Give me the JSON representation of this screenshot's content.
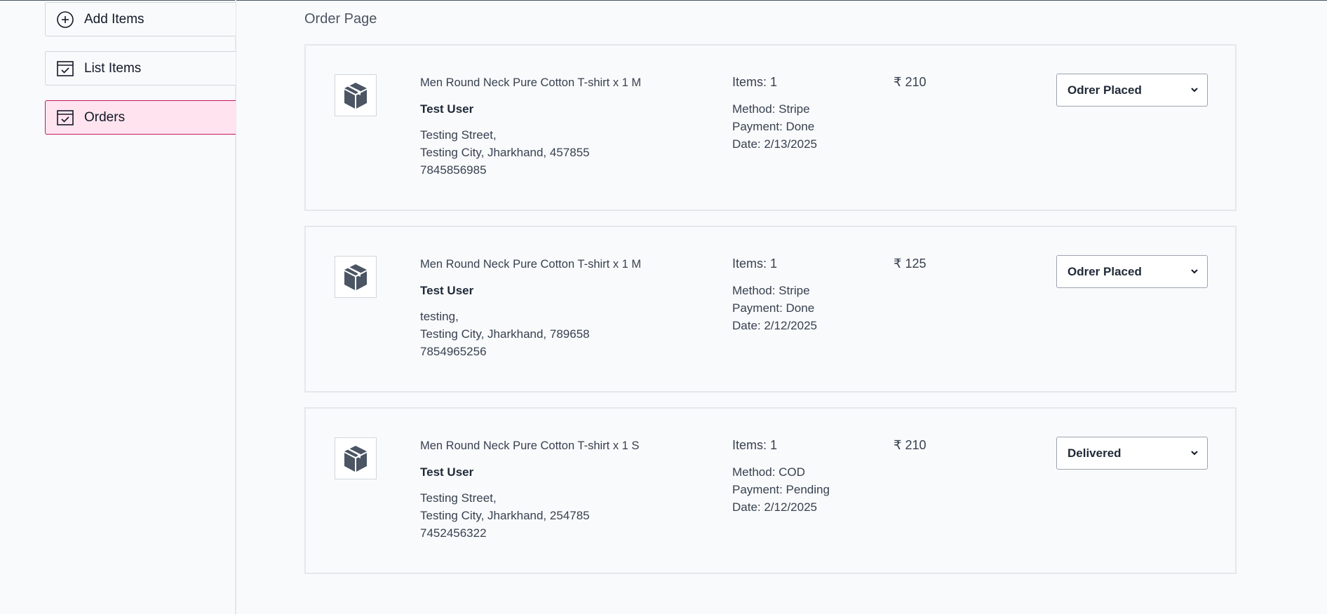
{
  "sidebar": {
    "items": [
      {
        "label": "Add Items",
        "icon": "plus-circle-icon"
      },
      {
        "label": "List Items",
        "icon": "calendar-check-icon"
      },
      {
        "label": "Orders",
        "icon": "calendar-check-icon",
        "active": true
      }
    ]
  },
  "main": {
    "title": "Order Page",
    "orders": [
      {
        "product": "Men Round Neck Pure Cotton T-shirt x 1 M",
        "customer": "Test User",
        "address_line1": "Testing Street,",
        "address_line2": "Testing City, Jharkhand, 457855",
        "phone": "7845856985",
        "items": "Items: 1",
        "method": "Method: Stripe",
        "payment": "Payment: Done",
        "date": "Date: 2/13/2025",
        "amount": "₹ 210",
        "status": "Odrer Placed"
      },
      {
        "product": "Men Round Neck Pure Cotton T-shirt x 1 M",
        "customer": "Test User",
        "address_line1": "testing,",
        "address_line2": "Testing City, Jharkhand, 789658",
        "phone": "7854965256",
        "items": "Items: 1",
        "method": "Method: Stripe",
        "payment": "Payment: Done",
        "date": "Date: 2/12/2025",
        "amount": "₹ 125",
        "status": "Odrer Placed"
      },
      {
        "product": "Men Round Neck Pure Cotton T-shirt x 1 S",
        "customer": "Test User",
        "address_line1": "Testing Street,",
        "address_line2": "Testing City, Jharkhand, 254785",
        "phone": "7452456322",
        "items": "Items: 1",
        "method": "Method: COD",
        "payment": "Payment: Pending",
        "date": "Date: 2/12/2025",
        "amount": "₹ 210",
        "status": "Delivered"
      }
    ]
  },
  "colors": {
    "active_bg": "#ffe4ef",
    "active_border": "#c2185b",
    "page_bg": "#f9fafb"
  }
}
